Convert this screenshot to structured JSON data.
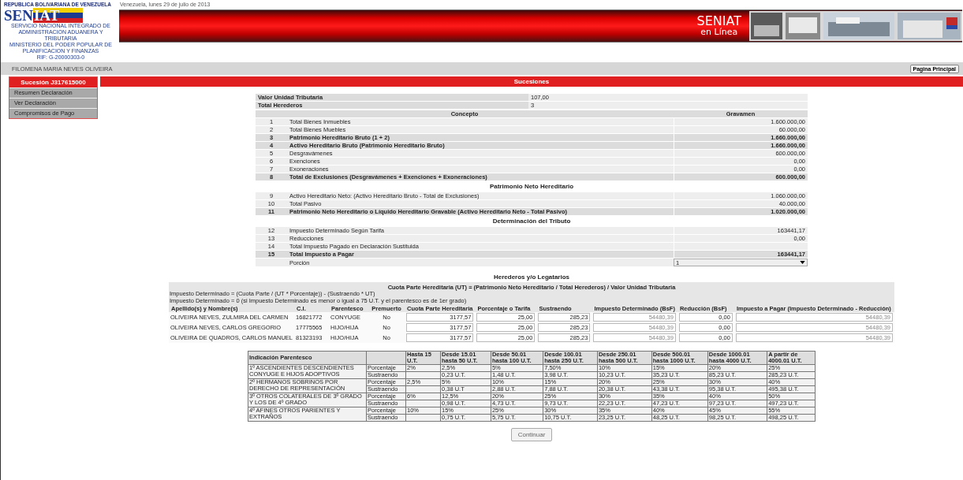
{
  "header": {
    "country": "REPUBLICA BOLIVARIANA DE VENEZUELA",
    "logo_parts": [
      "SEN",
      "IAT"
    ],
    "agency_lines": [
      "SERVICIO NACIONAL INTEGRADO DE ADMINISTRACION ADUANERA Y TRIBUTARIA",
      "MINISTERIO DEL PODER POPULAR DE PLANIFICACION Y FINANZAS",
      "RIF: G-20000303-0"
    ],
    "date": "Venezuela, lunes 29 de julio de 2013",
    "brand": "SENIAT",
    "brand_sub": "en Línea"
  },
  "user_name": "FILOMENA MARIA NEVES OLIVEIRA",
  "home_button": "Pagina Principal",
  "sidebar": {
    "title": "Sucesión J317615000",
    "items": [
      {
        "label": "Resumen Declaración"
      },
      {
        "label": "Ver Declaración"
      },
      {
        "label": "Compromisos de Pago"
      }
    ]
  },
  "section_title": "Sucesiones",
  "summary": [
    {
      "label": "Valor Unidad Tributaria",
      "value": "107,00"
    },
    {
      "label": "Total Herederos",
      "value": "3"
    }
  ],
  "concepts": {
    "columns": [
      "Concepto",
      "Gravamen"
    ],
    "groups": [
      {
        "rows": [
          {
            "num": "1",
            "label": "Total Bienes Inmuebles",
            "value": "1.600.000,00",
            "total": false
          },
          {
            "num": "2",
            "label": "Total Bienes Muebles",
            "value": "60.000,00",
            "total": false
          },
          {
            "num": "3",
            "label": "Patrimonio Hereditario Bruto (1 + 2)",
            "value": "1.660.000,00",
            "total": true
          },
          {
            "num": "4",
            "label": "Activo Hereditario Bruto (Patrimonio Hereditario Bruto)",
            "value": "1.660.000,00",
            "total": true
          },
          {
            "num": "5",
            "label": "Desgravámenes",
            "value": "600.000,00",
            "total": false
          },
          {
            "num": "6",
            "label": "Exenciones",
            "value": "0,00",
            "total": false
          },
          {
            "num": "7",
            "label": "Exoneraciones",
            "value": "0,00",
            "total": false
          },
          {
            "num": "8",
            "label": "Total de Exclusiones (Desgravámenes + Exenciones + Exoneraciones)",
            "value": "600.000,00",
            "total": true
          }
        ]
      },
      {
        "title": "Patrimonio Neto Hereditario",
        "rows": [
          {
            "num": "9",
            "label": "Activo Hereditario Neto: (Activo Hereditario Bruto - Total de Exclusiones)",
            "value": "1.060.000,00",
            "total": false
          },
          {
            "num": "10",
            "label": "Total Pasivo",
            "value": "40.000,00",
            "total": false
          },
          {
            "num": "11",
            "label": "Patrimonio Neto Hereditario o Líquido Hereditario Gravable (Activo Hereditario Neto - Total Pasivo)",
            "value": "1.020.000,00",
            "total": true
          }
        ]
      },
      {
        "title": "Determinación del Tributo",
        "rows": [
          {
            "num": "12",
            "label": "Impuesto Determinado Según Tarifa",
            "value": "163441,17",
            "total": false
          },
          {
            "num": "13",
            "label": "Reducciones",
            "value": "0,00",
            "total": false
          },
          {
            "num": "14",
            "label": "Total Impuesto Pagado en Declaración Sustituida",
            "total": false
          },
          {
            "num": "15",
            "label": "Total Impuesto a Pagar",
            "value": "163441,17",
            "total": true
          }
        ]
      }
    ]
  },
  "porcion": {
    "label": "Porción",
    "value": "1"
  },
  "heirs": {
    "title": "Herederos y/o Legatarios",
    "formula": "Cuota Parte Hereditaria (UT) = (Patrimonio Neto Hereditario / Total Herederos) / Valor Unidad Tributaria",
    "notes": [
      "Impuesto Determinado = (Cuota Parte / (UT * Porcentaje)) - (Sustraendo * UT)",
      "Impuesto Determinado = 0 (si Impuesto Determinado es menor o igual a 75 U.T. y el parentesco es de 1er grado)"
    ],
    "columns": [
      {
        "label": "Apellido(s) y Nombre(s)",
        "kind": "text"
      },
      {
        "label": "C.I.",
        "kind": "text"
      },
      {
        "label": "Parentesco",
        "kind": "text"
      },
      {
        "label": "Premuerto",
        "kind": "center"
      },
      {
        "label": "Cuota Parte Hereditaria",
        "kind": "input"
      },
      {
        "label": "Porcentaje o Tarifa",
        "kind": "input"
      },
      {
        "label": "Sustraendo",
        "kind": "input"
      },
      {
        "label": "Impuesto Determinado (BsF)",
        "kind": "readonly"
      },
      {
        "label": "Reducción (BsF)",
        "kind": "input"
      },
      {
        "label": "Impuesto a Pagar (Impuesto Determinado - Reducción)",
        "kind": "readonly"
      }
    ],
    "rows": [
      [
        "OLIVEIRA NEVES, ZULMIRA DEL CARMEN",
        "16821772",
        "CONYUGE",
        "No",
        "3177,57",
        "25,00",
        "285,23",
        "54480,39",
        "0,00",
        "54480,39"
      ],
      [
        "OLIVEIRA NEVES, CARLOS GREGORIO",
        "17775565",
        "HIJO/HIJA",
        "No",
        "3177,57",
        "25,00",
        "285,23",
        "54480,39",
        "0,00",
        "54480,39"
      ],
      [
        "OLIVEIRA DE QUADROS, CARLOS MANUEL",
        "81323193",
        "HIJO/HIJA",
        "No",
        "3177,57",
        "25,00",
        "285,23",
        "54480,39",
        "0,00",
        "54480,39"
      ]
    ]
  },
  "rates": {
    "columns": [
      "Indicación Parentesco",
      "Hasta 15 U.T.",
      "Desde 15.01 hasta 50 U.T.",
      "Desde 50.01 hasta 100 U.T.",
      "Desde 100.01 hasta 250 U.T.",
      "Desde 250.01 hasta 500 U.T.",
      "Desde 500.01 hasta 1000 U.T.",
      "Desde 1000.01 hasta 4000 U.T.",
      "A partir de 4000.01 U.T."
    ],
    "groups": [
      {
        "label": "1º ASCENDIENTES DESCENDIENTES CONYUGE E HIJOS ADOPTIVOS",
        "rows": [
          {
            "label": "Porcentaje",
            "blank_first": false,
            "values": [
              "2%",
              "2,5%",
              "5%",
              "7,50%",
              "10%",
              "15%",
              "20%",
              "25%"
            ]
          },
          {
            "label": "Sustraendo",
            "blank_first": true,
            "values": [
              "0,23 U.T.",
              "1,48 U.T.",
              "3,98 U.T.",
              "10,23 U.T.",
              "35,23 U.T.",
              "85,23 U.T.",
              "285,23 U.T."
            ]
          }
        ]
      },
      {
        "label": "2º HERMANOS SOBRINOS POR DERECHO DE REPRESENTACIÓN",
        "rows": [
          {
            "label": "Porcentaje",
            "blank_first": false,
            "values": [
              "2,5%",
              "5%",
              "10%",
              "15%",
              "20%",
              "25%",
              "30%",
              "40%"
            ]
          },
          {
            "label": "Sustraendo",
            "blank_first": true,
            "values": [
              "0,38 U.T",
              "2,88 U.T.",
              "7,88 U.T.",
              "20,38 U.T.",
              "43,38 U.T.",
              "95,38 U.T.",
              "495,38 U.T."
            ]
          }
        ]
      },
      {
        "label": "3º OTROS COLATERALES DE 3º GRADO Y LOS DE 4º GRADO",
        "rows": [
          {
            "label": "Porcentaje",
            "blank_first": false,
            "values": [
              "6%",
              "12,5%",
              "20%",
              "25%",
              "30%",
              "35%",
              "40%",
              "50%"
            ]
          },
          {
            "label": "Sustraendo",
            "blank_first": true,
            "values": [
              "0,98 U.T.",
              "4,73 U.T.",
              "9,73 U.T.",
              "22,23 U.T.",
              "47,23 U.T.",
              "97,23 U.T.",
              "497,23 U.T."
            ]
          }
        ]
      },
      {
        "label": "4º AFINES OTROS PARIENTES Y EXTRAÑOS",
        "rows": [
          {
            "label": "Porcentaje",
            "blank_first": false,
            "values": [
              "10%",
              "15%",
              "25%",
              "30%",
              "35%",
              "40%",
              "45%",
              "55%"
            ]
          },
          {
            "label": "Sustraendo",
            "blank_first": true,
            "values": [
              "0,75 U.T.",
              "5,75 U.T.",
              "10,75 U.T.",
              "23,25 U.T.",
              "48,25 U.T.",
              "98,25 U.T.",
              "498,25 U.T."
            ]
          }
        ]
      }
    ]
  },
  "continue_button": "Continuar"
}
